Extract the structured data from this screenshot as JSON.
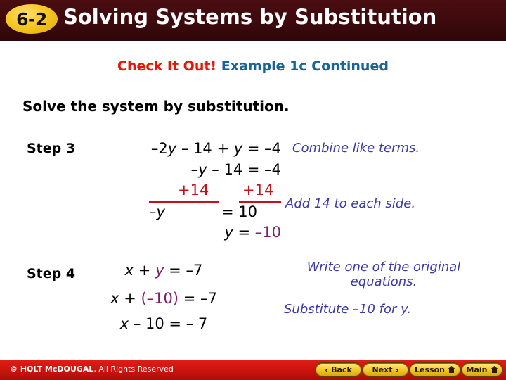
{
  "header": {
    "badge": "6-2",
    "title": "Solving Systems by Substitution",
    "bar_color": "#3d0a0d",
    "badge_color": "#f5c724"
  },
  "subtitle": {
    "highlight": "Check It Out!",
    "highlight_color": "#e8140a",
    "rest": "Example 1c Continued",
    "rest_color": "#1c6292"
  },
  "prompt": "Solve the system by substitution.",
  "steps": [
    {
      "label": "Step 3",
      "lines": [
        {
          "text": "–2y – 14 + y = –4"
        },
        {
          "text": "–y – 14 =  –4"
        },
        {
          "left": "+14",
          "right": "+14",
          "color": "#c41218"
        },
        {
          "left": "–y",
          "right": "= 10"
        },
        {
          "text": "y = –10",
          "accent": "–10",
          "accent_color": "#7d1d6d"
        }
      ],
      "notes": [
        "Combine like terms.",
        "Add 14 to each side."
      ]
    },
    {
      "label": "Step 4",
      "lines": [
        {
          "text": "x + y = –7",
          "accent": "y",
          "accent_color": "#7d1d6d"
        },
        {
          "text": "x + (–10) = –7",
          "accent": "(–10)",
          "accent_color": "#7d1d6d"
        },
        {
          "text": "x – 10 = – 7"
        }
      ],
      "notes": [
        "Write one of the original equations.",
        "Substitute –10 for y."
      ]
    }
  ],
  "footer": {
    "copyright_strong": "© HOLT McDOUGAL",
    "copyright_rest": ", All Rights Reserved",
    "bar_color": "#c8120d",
    "buttons": [
      {
        "label": "Back",
        "icon": "chevron-left-icon",
        "glyph": "‹"
      },
      {
        "label": "Next",
        "icon": "chevron-right-icon",
        "glyph": "›"
      },
      {
        "label": "Lesson",
        "icon": "home-icon",
        "glyph": "⌂"
      },
      {
        "label": "Main",
        "icon": "home-icon",
        "glyph": "⌂"
      }
    ]
  }
}
